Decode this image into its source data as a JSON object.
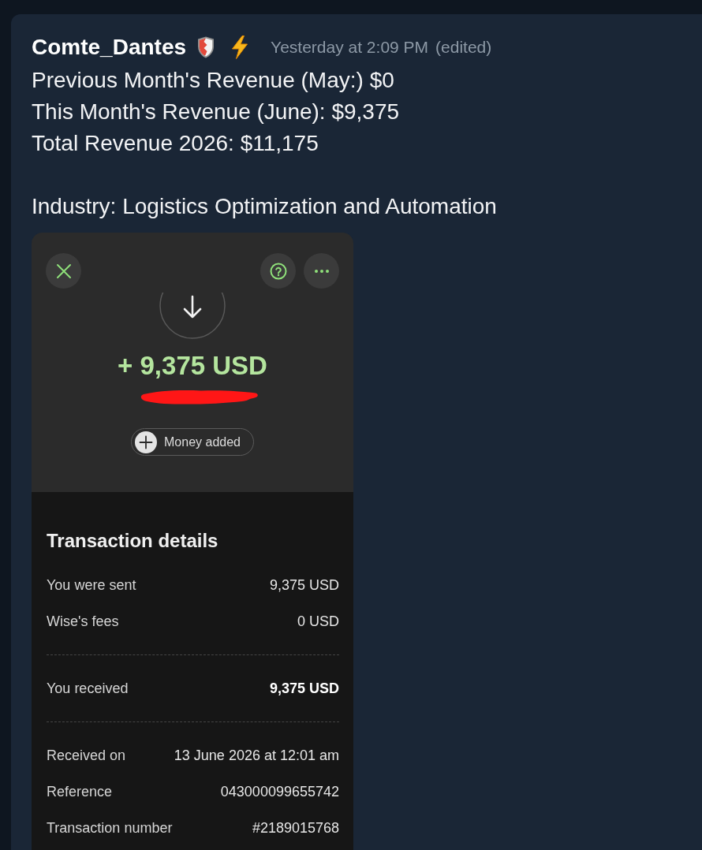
{
  "message": {
    "author": "Comte_Dantes",
    "timestamp": "Yesterday at 2:09 PM",
    "edited_label": "(edited)",
    "paragraphs": [
      {
        "lines": [
          "Previous Month's Revenue (May:) $0",
          "This Month's Revenue (June): $9,375",
          "Total Revenue 2026: $11,175"
        ]
      },
      {
        "lines": [
          "Industry: Logistics Optimization and Automation"
        ]
      }
    ]
  },
  "attachment": {
    "amount": "+ 9,375 USD",
    "status": "Money added",
    "details_title": "Transaction details",
    "sections": [
      {
        "rows": [
          {
            "label": "You were sent",
            "value": "9,375 USD",
            "emphasized": false
          },
          {
            "label": "Wise's fees",
            "value": "0 USD",
            "emphasized": false
          }
        ]
      },
      {
        "rows": [
          {
            "label": "You received",
            "value": "9,375 USD",
            "emphasized": true
          }
        ]
      },
      {
        "rows": [
          {
            "label": "Received on",
            "value": "13 June 2026 at 12:01 am",
            "emphasized": false
          },
          {
            "label": "Reference",
            "value": "043000099655742",
            "emphasized": false
          },
          {
            "label": "Transaction number",
            "value": "#2189015768",
            "emphasized": false
          }
        ]
      }
    ]
  }
}
